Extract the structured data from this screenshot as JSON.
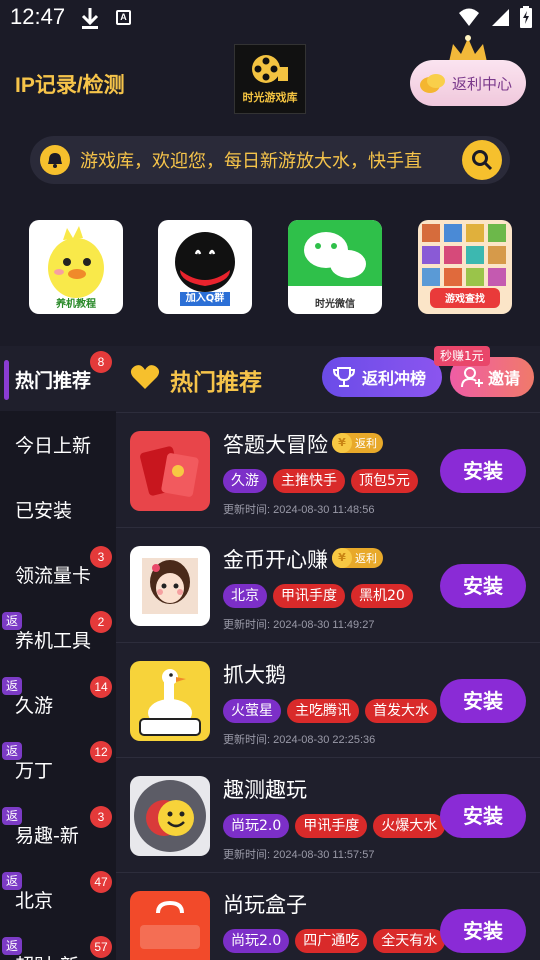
{
  "status_bar": {
    "time": "12:47"
  },
  "header": {
    "ip_title": "IP记录/检测",
    "logo_text": "时光游戏库",
    "rebate_center_label": "返利中心",
    "notice_text": "游戏库，欢迎您，每日新游放大水，快手直"
  },
  "shortcuts": [
    {
      "name": "养机教程",
      "icon": "duck-mascot-icon"
    },
    {
      "name": "加入Q群",
      "icon": "qq-penguin-icon"
    },
    {
      "name": "时光微信",
      "icon": "wechat-icon"
    },
    {
      "name": "游戏查找",
      "icon": "game-grid-icon"
    }
  ],
  "sidebar": {
    "items": [
      {
        "label": "热门推荐",
        "badge": "8",
        "fan": "",
        "active": true
      },
      {
        "label": "今日上新",
        "badge": "",
        "fan": ""
      },
      {
        "label": "已安装",
        "badge": "",
        "fan": ""
      },
      {
        "label": "领流量卡",
        "badge": "3",
        "fan": ""
      },
      {
        "label": "养机工具",
        "badge": "2",
        "fan": "返"
      },
      {
        "label": "久游",
        "badge": "14",
        "fan": "返"
      },
      {
        "label": "万丁",
        "badge": "12",
        "fan": "返"
      },
      {
        "label": "易趣-新",
        "badge": "3",
        "fan": "返"
      },
      {
        "label": "北京",
        "badge": "47",
        "fan": "返"
      },
      {
        "label": "超财-新",
        "badge": "57",
        "fan": "返"
      }
    ]
  },
  "main": {
    "title": "热门推荐",
    "rank_label": "返利冲榜",
    "invite_label": "邀请",
    "earn_tip": "秒赚1元",
    "install_label": "安装",
    "rebate_label": "返利",
    "games": [
      {
        "name": "答题大冒险",
        "rebate": true,
        "tags": [
          {
            "t": "久游",
            "c": "purple"
          },
          {
            "t": "主推快手",
            "c": "red"
          },
          {
            "t": "顶包5元",
            "c": "red"
          }
        ],
        "updated": "更新时间: 2024-08-30 11:48:56",
        "icon": "red-envelope-icon"
      },
      {
        "name": "金币开心赚",
        "rebate": true,
        "tags": [
          {
            "t": "北京",
            "c": "purple"
          },
          {
            "t": "甲讯手度",
            "c": "red"
          },
          {
            "t": "黑机20",
            "c": "red"
          }
        ],
        "updated": "更新时间: 2024-08-30 11:49:27",
        "icon": "girl-avatar-icon"
      },
      {
        "name": "抓大鹅",
        "rebate": false,
        "tags": [
          {
            "t": "火萤星",
            "c": "purple"
          },
          {
            "t": "主吃腾讯",
            "c": "red"
          },
          {
            "t": "首发大水",
            "c": "red"
          }
        ],
        "updated": "更新时间: 2024-08-30 22:25:36",
        "icon": "goose-icon"
      },
      {
        "name": "趣测趣玩",
        "rebate": false,
        "tags": [
          {
            "t": "尚玩2.0",
            "c": "purple"
          },
          {
            "t": "甲讯手度",
            "c": "red"
          },
          {
            "t": "火爆大水",
            "c": "red"
          }
        ],
        "updated": "更新时间: 2024-08-30 11:57:57",
        "icon": "smiley-coin-icon"
      },
      {
        "name": "尚玩盒子",
        "rebate": false,
        "tags": [
          {
            "t": "尚玩2.0",
            "c": "purple"
          },
          {
            "t": "四广通吃",
            "c": "red"
          },
          {
            "t": "全天有水",
            "c": "red"
          }
        ],
        "updated": "",
        "icon": "shangwan-bag-icon"
      }
    ]
  },
  "colors": {
    "accent_yellow": "#f6c44a",
    "install_purple": "#8a2bd6",
    "badge_red": "#e43a3a",
    "bg": "#1f1f2c"
  }
}
